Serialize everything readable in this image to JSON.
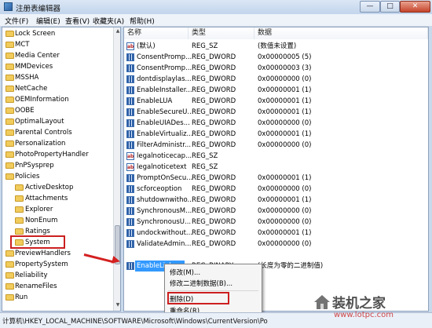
{
  "window": {
    "title": "注册表编辑器",
    "controls": {
      "minimize": "—",
      "maximize": "□",
      "close": "✕"
    }
  },
  "menu": [
    "文件(F)",
    "编辑(E)",
    "查看(V)",
    "收藏夹(A)",
    "帮助(H)"
  ],
  "tree": [
    {
      "label": "Lock Screen"
    },
    {
      "label": "MCT"
    },
    {
      "label": "Media Center"
    },
    {
      "label": "MMDevices"
    },
    {
      "label": "MSSHA"
    },
    {
      "label": "NetCache"
    },
    {
      "label": "OEMInformation"
    },
    {
      "label": "OOBE"
    },
    {
      "label": "OptimalLayout"
    },
    {
      "label": "Parental Controls"
    },
    {
      "label": "Personalization"
    },
    {
      "label": "PhotoPropertyHandler"
    },
    {
      "label": "PnPSysprep"
    },
    {
      "label": "Policies"
    },
    {
      "label": "ActiveDesktop"
    },
    {
      "label": "Attachments"
    },
    {
      "label": "Explorer"
    },
    {
      "label": "NonEnum"
    },
    {
      "label": "Ratings"
    },
    {
      "label": "System",
      "highlighted": true
    },
    {
      "label": "PreviewHandlers"
    },
    {
      "label": "PropertySystem"
    },
    {
      "label": "Reliability"
    },
    {
      "label": "RenameFiles"
    },
    {
      "label": "Run"
    }
  ],
  "columns": {
    "name": "名称",
    "type": "类型",
    "data": "数据"
  },
  "values": [
    {
      "name": "(默认)",
      "type": "REG_SZ",
      "data": "(数值未设置)",
      "icon": "string-value-icon"
    },
    {
      "name": "ConsentPromp...",
      "type": "REG_DWORD",
      "data": "0x00000005 (5)",
      "icon": "dword-value-icon"
    },
    {
      "name": "ConsentPromp...",
      "type": "REG_DWORD",
      "data": "0x00000003 (3)",
      "icon": "dword-value-icon"
    },
    {
      "name": "dontdisplaylas...",
      "type": "REG_DWORD",
      "data": "0x00000000 (0)",
      "icon": "dword-value-icon"
    },
    {
      "name": "EnableInstaller...",
      "type": "REG_DWORD",
      "data": "0x00000001 (1)",
      "icon": "dword-value-icon"
    },
    {
      "name": "EnableLUA",
      "type": "REG_DWORD",
      "data": "0x00000001 (1)",
      "icon": "dword-value-icon"
    },
    {
      "name": "EnableSecureU...",
      "type": "REG_DWORD",
      "data": "0x00000001 (1)",
      "icon": "dword-value-icon"
    },
    {
      "name": "EnableUIADes...",
      "type": "REG_DWORD",
      "data": "0x00000000 (0)",
      "icon": "dword-value-icon"
    },
    {
      "name": "EnableVirtualiz...",
      "type": "REG_DWORD",
      "data": "0x00000001 (1)",
      "icon": "dword-value-icon"
    },
    {
      "name": "FilterAdministr...",
      "type": "REG_DWORD",
      "data": "0x00000000 (0)",
      "icon": "dword-value-icon"
    },
    {
      "name": "legalnoticecap...",
      "type": "REG_SZ",
      "data": "",
      "icon": "string-value-icon"
    },
    {
      "name": "legalnoticetext",
      "type": "REG_SZ",
      "data": "",
      "icon": "string-value-icon"
    },
    {
      "name": "PromptOnSecu...",
      "type": "REG_DWORD",
      "data": "0x00000001 (1)",
      "icon": "dword-value-icon"
    },
    {
      "name": "scforceoption",
      "type": "REG_DWORD",
      "data": "0x00000000 (0)",
      "icon": "dword-value-icon"
    },
    {
      "name": "shutdownwitho...",
      "type": "REG_DWORD",
      "data": "0x00000001 (1)",
      "icon": "dword-value-icon"
    },
    {
      "name": "SynchronousM...",
      "type": "REG_DWORD",
      "data": "0x00000000 (0)",
      "icon": "dword-value-icon"
    },
    {
      "name": "SynchronousU...",
      "type": "REG_DWORD",
      "data": "0x00000000 (0)",
      "icon": "dword-value-icon"
    },
    {
      "name": "undockwithout...",
      "type": "REG_DWORD",
      "data": "0x00000001 (1)",
      "icon": "dword-value-icon"
    },
    {
      "name": "ValidateAdmin...",
      "type": "REG_DWORD",
      "data": "0x00000000 (0)",
      "icon": "dword-value-icon"
    },
    {
      "name": "EnableLinke...",
      "type": "REG_BINARY",
      "data": "(长度为零的二进制值)",
      "icon": "binary-value-icon",
      "selected": true
    }
  ],
  "context_menu": [
    {
      "label": "修改(M)..."
    },
    {
      "label": "修改二进制数据(B)..."
    },
    {
      "label": "删除(D)",
      "highlighted": true
    },
    {
      "label": "重命名(R)"
    }
  ],
  "status": "计算机\\HKEY_LOCAL_MACHINE\\SOFTWARE\\Microsoft\\Windows\\CurrentVersion\\Po",
  "watermark": {
    "text": "装机之家",
    "url": "www.lotpc.com"
  },
  "colors": {
    "selection": "#3399ff",
    "annotation": "#cc1f1f",
    "folder": "#f1cc5c"
  }
}
